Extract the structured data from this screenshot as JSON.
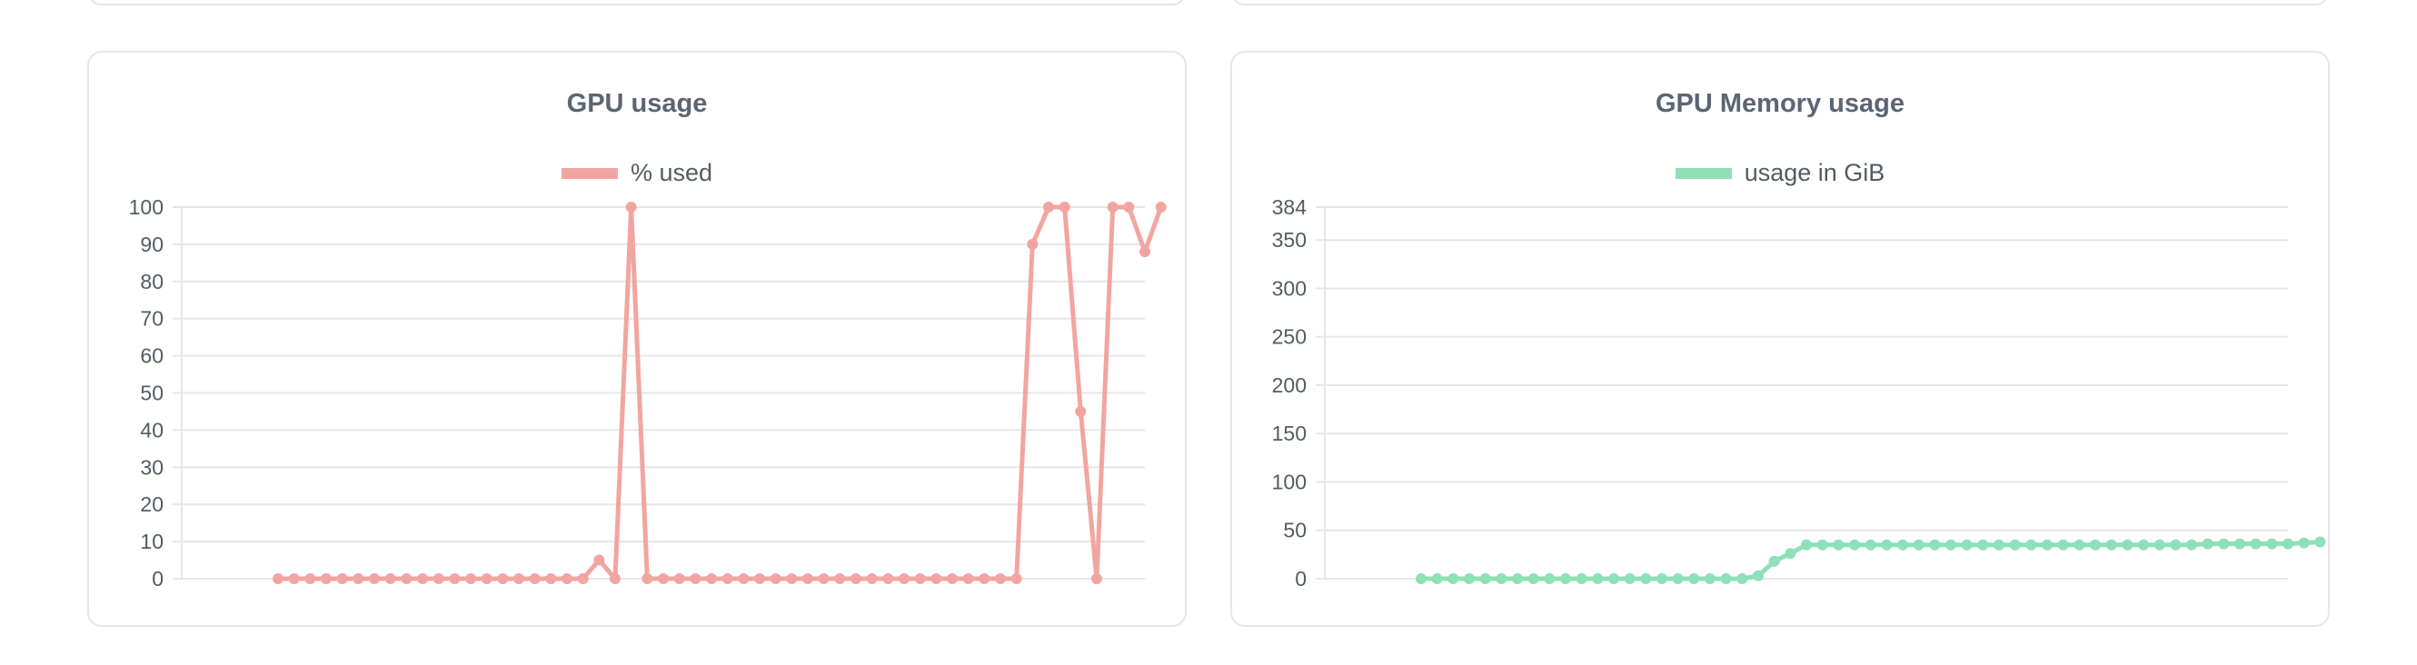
{
  "colors": {
    "gpu": "#f2a5a0",
    "memory": "#8ee0b6"
  },
  "chart_data": [
    {
      "type": "line",
      "title": "GPU usage",
      "legend_position": "top",
      "grid": true,
      "ylim": [
        0,
        100
      ],
      "y_ticks": [
        0,
        10,
        20,
        30,
        40,
        50,
        60,
        70,
        80,
        90,
        100
      ],
      "x_count": 61,
      "series": [
        {
          "name": "% used",
          "color": "#f2a5a0",
          "values": [
            null,
            null,
            null,
            null,
            null,
            null,
            0,
            0,
            0,
            0,
            0,
            0,
            0,
            0,
            0,
            0,
            0,
            0,
            0,
            0,
            0,
            0,
            0,
            0,
            0,
            0,
            5,
            0,
            100,
            0,
            0,
            0,
            0,
            0,
            0,
            0,
            0,
            0,
            0,
            0,
            0,
            0,
            0,
            0,
            0,
            0,
            0,
            0,
            0,
            0,
            0,
            0,
            0,
            90,
            100,
            100,
            45,
            0,
            100,
            100,
            88,
            100
          ]
        }
      ]
    },
    {
      "type": "line",
      "title": "GPU Memory usage",
      "legend_position": "top",
      "grid": true,
      "ylim": [
        0,
        384
      ],
      "y_ticks": [
        0,
        50,
        100,
        150,
        200,
        250,
        300,
        350,
        384
      ],
      "x_count": 61,
      "series": [
        {
          "name": "usage in GiB",
          "color": "#8ee0b6",
          "values": [
            null,
            null,
            null,
            null,
            null,
            null,
            0,
            0,
            0,
            0,
            0,
            0,
            0,
            0,
            0,
            0,
            0,
            0,
            0,
            0,
            0,
            0,
            0,
            0,
            0,
            0,
            0,
            3,
            18,
            26,
            35,
            35,
            35,
            35,
            35,
            35,
            35,
            35,
            35,
            35,
            35,
            35,
            35,
            35,
            35,
            35,
            35,
            35,
            35,
            35,
            35,
            35,
            35,
            35,
            35,
            36,
            36,
            36,
            36,
            36,
            36,
            37,
            38
          ]
        }
      ]
    }
  ]
}
